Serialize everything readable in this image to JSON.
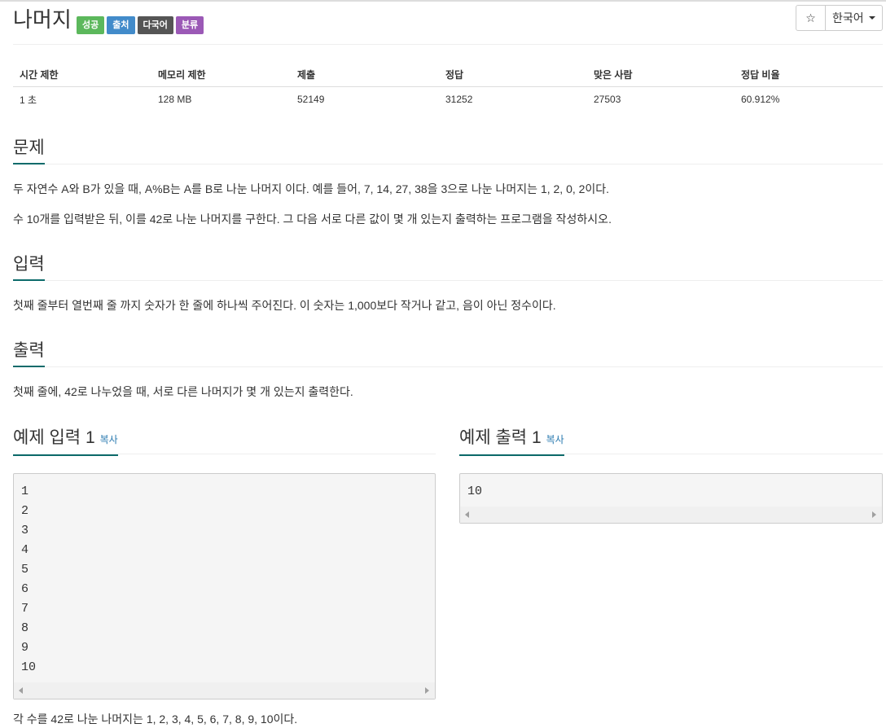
{
  "problem": {
    "title": "나머지",
    "labels": [
      {
        "text": "성공",
        "color": "#5cb85c"
      },
      {
        "text": "출처",
        "color": "#428bca"
      },
      {
        "text": "다국어",
        "color": "#555555"
      },
      {
        "text": "분류",
        "color": "#9b59b6"
      }
    ],
    "star_icon": "☆",
    "language": "한국어"
  },
  "info_table": {
    "headers": [
      "시간 제한",
      "메모리 제한",
      "제출",
      "정답",
      "맞은 사람",
      "정답 비율"
    ],
    "row": [
      "1 초",
      "128 MB",
      "52149",
      "31252",
      "27503",
      "60.912%"
    ]
  },
  "description": {
    "heading": "문제",
    "paragraphs": [
      "두 자연수 A와 B가 있을 때, A%B는 A를 B로 나눈 나머지 이다. 예를 들어, 7, 14, 27, 38을 3으로 나눈 나머지는 1, 2, 0, 2이다.",
      "수 10개를 입력받은 뒤, 이를 42로 나눈 나머지를 구한다. 그 다음 서로 다른 값이 몇 개 있는지 출력하는 프로그램을 작성하시오."
    ]
  },
  "input": {
    "heading": "입력",
    "text": "첫째 줄부터 열번째 줄 까지 숫자가 한 줄에 하나씩 주어진다. 이 숫자는 1,000보다 작거나 같고, 음이 아닌 정수이다."
  },
  "output": {
    "heading": "출력",
    "text": "첫째 줄에, 42로 나누었을 때, 서로 다른 나머지가 몇 개 있는지 출력한다."
  },
  "sample_input": {
    "heading": "예제 입력 1",
    "copy_label": "복사",
    "lines": [
      "1",
      "2",
      "3",
      "4",
      "5",
      "6",
      "7",
      "8",
      "9",
      "10"
    ]
  },
  "sample_output": {
    "heading": "예제 출력 1",
    "copy_label": "복사",
    "lines": [
      "10"
    ]
  },
  "sample_note": "각 수를 42로 나눈 나머지는 1, 2, 3, 4, 5, 6, 7, 8, 9, 10이다.",
  "colors": {
    "heading_underline": "#0d6b6b",
    "link": "#2a7ab0"
  }
}
